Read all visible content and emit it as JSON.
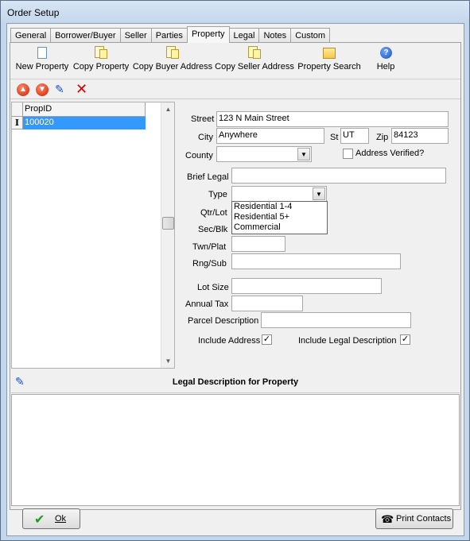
{
  "window": {
    "title": "Order Setup"
  },
  "tabs": [
    {
      "label": "General"
    },
    {
      "label": "Borrower/Buyer"
    },
    {
      "label": "Seller"
    },
    {
      "label": "Parties"
    },
    {
      "label": "Property"
    },
    {
      "label": "Legal"
    },
    {
      "label": "Notes"
    },
    {
      "label": "Custom"
    }
  ],
  "toolbar": {
    "new_property": "New Property",
    "copy_property": "Copy Property",
    "copy_buyer_address": "Copy Buyer Address",
    "copy_seller_address": "Copy Seller Address",
    "property_search": "Property Search",
    "help": "Help"
  },
  "grid": {
    "column": "PropID",
    "rows": [
      {
        "prop_id": "100020"
      }
    ]
  },
  "form": {
    "street_label": "Street",
    "street_value": "123 N Main Street",
    "city_label": "City",
    "city_value": "Anywhere",
    "st_label": "St",
    "st_value": "UT",
    "zip_label": "Zip",
    "zip_value": "84123",
    "county_label": "County",
    "county_value": "",
    "address_verified_label": "Address Verified?",
    "brief_legal_label": "Brief Legal",
    "brief_legal_value": "",
    "type_label": "Type",
    "type_value": "",
    "type_options": [
      "Residential 1-4",
      "Residential 5+",
      "Commercial"
    ],
    "qtr_lot_label": "Qtr/Lot",
    "sec_blk_label": "Sec/Blk",
    "twn_plat_label": "Twn/Plat",
    "twn_plat_value": "",
    "rng_sub_label": "Rng/Sub",
    "rng_sub_value": "",
    "lot_size_label": "Lot Size",
    "lot_size_value": "",
    "annual_tax_label": "Annual Tax",
    "annual_tax_value": "",
    "parcel_description_label": "Parcel Description",
    "parcel_description_value": "",
    "include_address_label": "Include Address",
    "include_address_checked": "✓",
    "include_legal_label": "Include Legal Description",
    "include_legal_checked": "✓"
  },
  "legal": {
    "title": "Legal Description for Property",
    "text": ""
  },
  "buttons": {
    "ok": "Ok",
    "print_contacts": "Print Contacts"
  }
}
